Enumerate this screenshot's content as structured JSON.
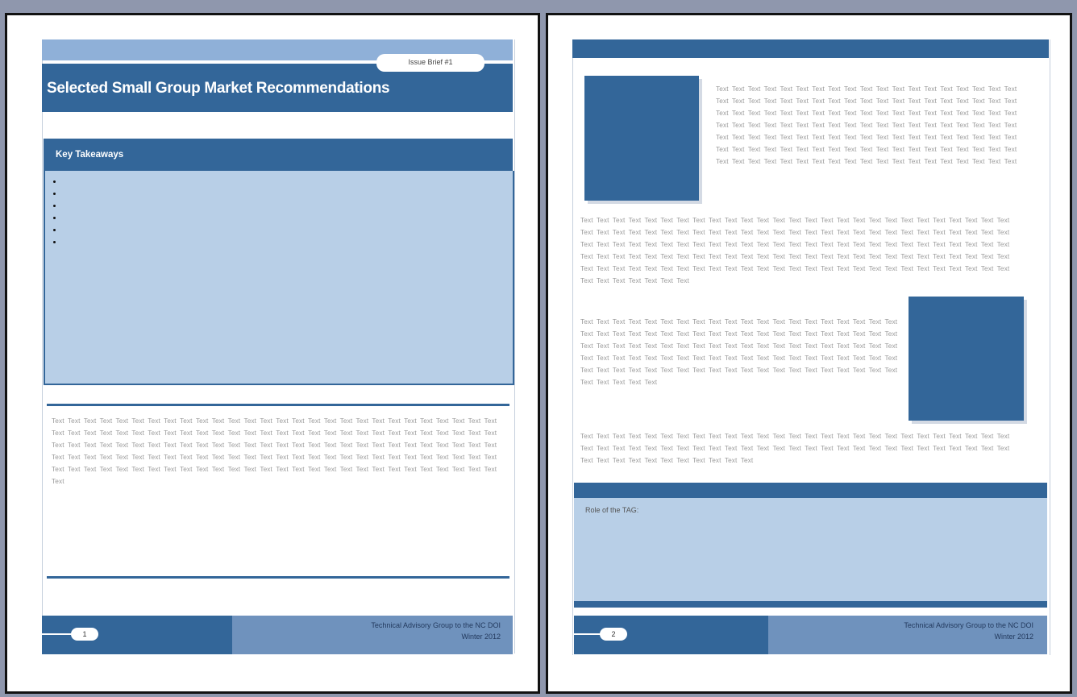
{
  "page1": {
    "issue_label": "Issue Brief #1",
    "title": "Selected Small Group Market Recommendations",
    "takeaways_heading": "Key Takeaways",
    "bullet_count": 6,
    "body_text": "Text Text Text Text Text Text Text Text Text Text Text Text Text Text Text Text Text Text Text Text Text Text Text Text Text Text Text Text Text Text Text Text Text Text Text Text Text Text Text Text Text Text Text Text Text Text Text Text Text Text Text Text Text Text Text Text Text Text Text Text Text Text Text Text Text Text Text Text Text Text Text Text Text Text Text Text Text Text Text Text Text Text Text Text Text Text Text Text Text Text Text Text Text Text Text Text Text Text Text Text Text Text Text Text Text Text Text Text Text Text Text Text Text Text Text Text Text Text Text Text Text Text Text Text Text Text Text Text Text Text Text Text Text Text Text Text Text Text Text Text Text",
    "page_number": "1",
    "footer_line1": "Technical Advisory Group to the NC DOI",
    "footer_line2": "Winter 2012"
  },
  "page2": {
    "text_block_1": "Text Text Text Text Text Text Text Text Text Text Text Text Text Text Text Text Text Text Text Text Text Text Text Text Text Text Text Text Text Text Text Text Text Text Text Text Text Text Text Text Text Text Text Text Text Text Text Text Text Text Text Text Text Text Text Text Text Text Text Text Text Text Text Text Text Text Text Text Text Text Text Text Text Text Text Text Text Text Text Text Text Text Text Text Text Text Text Text Text Text Text Text Text Text Text Text Text Text Text Text Text Text Text Text Text Text Text Text Text Text Text Text Text Text Text Text Text Text Text Text Text Text Text Text Text Text Text Text Text Text Text Text Text",
    "text_block_2": "Text Text Text Text Text Text Text Text Text Text Text Text Text Text Text Text Text Text Text Text Text Text Text Text Text Text Text Text Text Text Text Text Text Text Text Text Text Text Text Text Text Text Text Text Text Text Text Text Text Text Text Text Text Text Text Text Text Text Text Text Text Text Text Text Text Text Text Text Text Text Text Text Text Text Text Text Text Text Text Text Text Text Text Text Text Text Text Text Text Text Text Text Text Text Text Text Text Text Text Text Text Text Text Text Text Text Text Text Text Text Text Text Text Text Text Text Text Text Text Text Text Text Text Text Text Text Text Text Text Text Text Text Text Text Text Text Text Text Text Text Text Text",
    "text_block_3": "Text Text Text Text Text Text Text Text Text Text Text Text Text Text Text Text Text Text Text Text Text Text Text Text Text Text Text Text Text Text Text Text Text Text Text Text Text Text Text Text Text Text Text Text Text Text Text Text Text Text Text Text Text Text Text Text Text Text Text Text Text Text Text Text Text Text Text Text Text Text Text Text Text Text Text Text Text Text Text Text Text Text Text Text Text Text Text Text Text Text Text Text Text Text Text Text Text Text Text Text Text Text Text Text Text",
    "text_block_4": "Text Text Text Text Text Text Text Text Text Text Text Text Text Text Text Text Text Text Text Text Text Text Text Text Text Text Text Text Text Text Text Text Text Text Text Text Text Text Text Text Text Text Text Text Text Text Text Text Text Text Text Text Text Text Text Text Text Text Text Text Text Text Text Text Text",
    "role_label": "Role of the TAG:",
    "page_number": "2",
    "footer_line1": "Technical Advisory Group to the NC DOI",
    "footer_line2": "Winter 2012"
  },
  "colors": {
    "dark_blue": "#336699",
    "light_blue": "#b8cfe7",
    "mid_blue": "#6f92bd",
    "background": "#8f97ad"
  }
}
